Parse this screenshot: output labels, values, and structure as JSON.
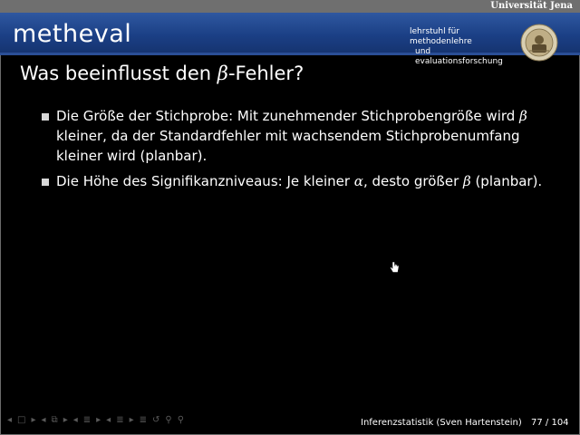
{
  "header": {
    "university": "Universität Jena",
    "logo": "metheval",
    "chair_line1": "lehrstuhl für methodenlehre",
    "chair_line2": "und evaluationsforschung"
  },
  "slide": {
    "title_prefix": "Was beeinflusst den ",
    "title_symbol": "β",
    "title_suffix": "-Fehler?",
    "bullets": [
      {
        "text_a": "Die Größe der Stichprobe: Mit zunehmender Stichprobengröße wird ",
        "sym_a": "β",
        "text_b": " kleiner, da der Standardfehler mit wachsendem Stichprobenumfang kleiner wird (planbar)."
      },
      {
        "text_a": "Die Höhe des Signifikanzniveaus: Je kleiner ",
        "sym_a": "α",
        "text_b": ", desto größer ",
        "sym_b": "β",
        "text_c": " (planbar)."
      }
    ]
  },
  "footer": {
    "presentation": "Inferenzstatistik (Sven Hartenstein)",
    "page": "77 / 104"
  },
  "nav": {
    "icons": [
      "◂",
      "□",
      "▸",
      "◂",
      "⧉",
      "▸",
      "◂",
      "≣",
      "▸",
      "◂",
      "≣",
      "▸",
      "≣",
      "↺",
      "⚲",
      "⚲"
    ]
  },
  "colors": {
    "banner": "#1b3f85",
    "topbar": "#6f6f6f",
    "background": "#000000",
    "bullet": "#d8d8d8"
  }
}
